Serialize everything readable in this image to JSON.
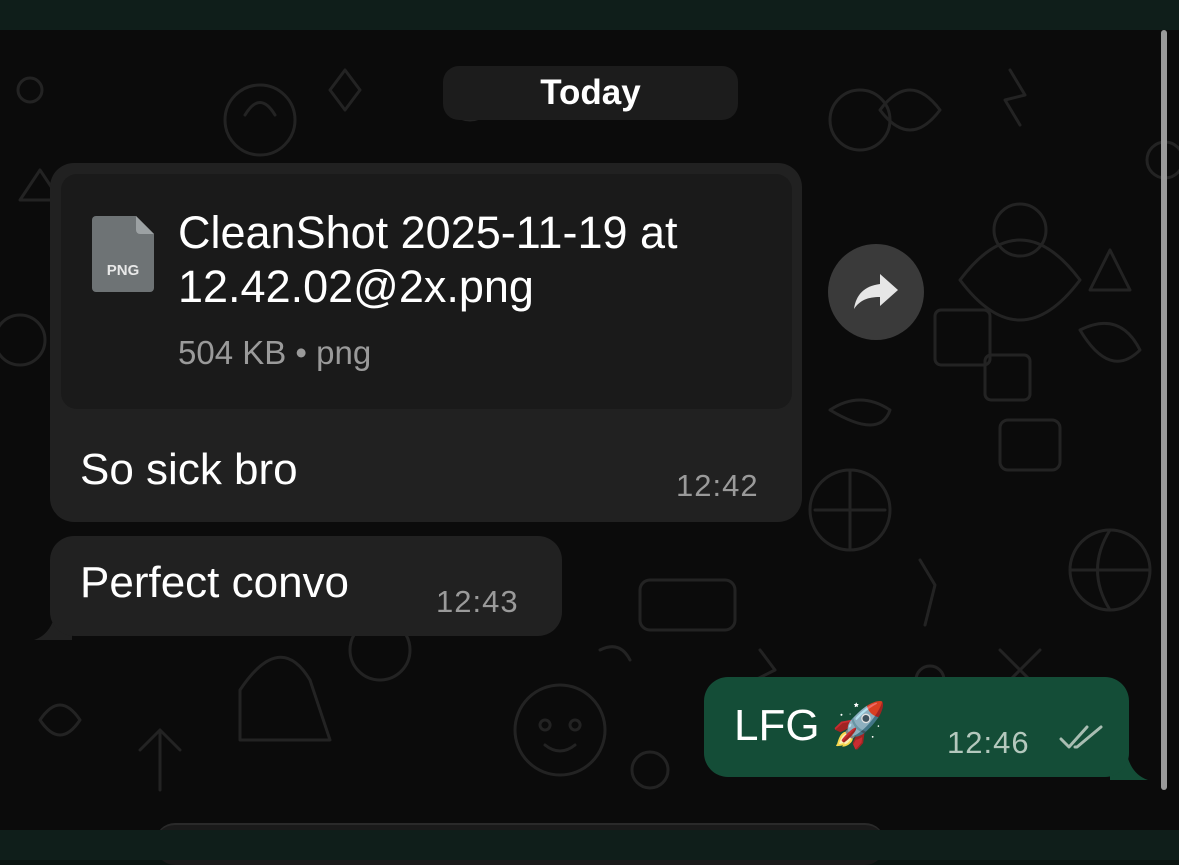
{
  "date_separator": "Today",
  "messages": [
    {
      "type": "file",
      "direction": "incoming",
      "file_name": "CleanShot 2025-11-19 at 12.42.02@2x.png",
      "file_icon_label": "PNG",
      "file_meta": "504 KB • png",
      "caption": "So sick bro",
      "time": "12:42"
    },
    {
      "type": "text",
      "direction": "incoming",
      "text": "Perfect convo",
      "time": "12:43"
    },
    {
      "type": "text",
      "direction": "outgoing",
      "text": "LFG 🚀",
      "time": "12:46",
      "status": "read"
    }
  ],
  "colors": {
    "incoming_bubble": "#212121",
    "outgoing_bubble": "#144d37",
    "background": "#0b0b0b",
    "header": "#0f1e1a"
  }
}
